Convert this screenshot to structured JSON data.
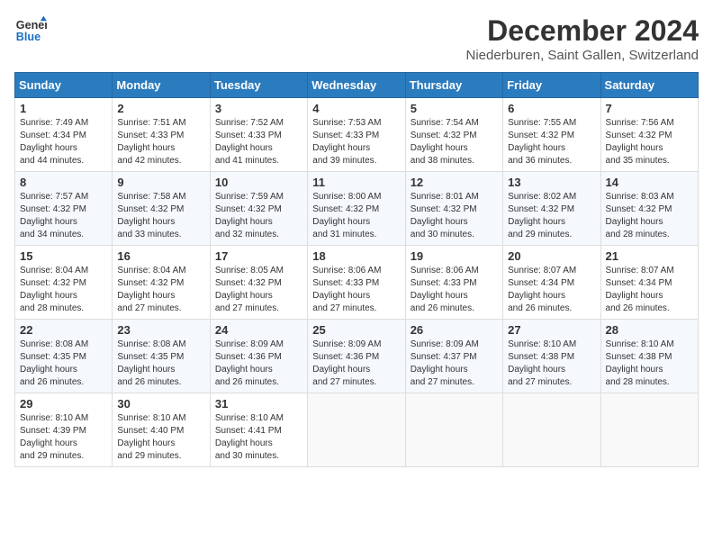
{
  "logo": {
    "line1": "General",
    "line2": "Blue"
  },
  "title": "December 2024",
  "subtitle": "Niederburen, Saint Gallen, Switzerland",
  "days_of_week": [
    "Sunday",
    "Monday",
    "Tuesday",
    "Wednesday",
    "Thursday",
    "Friday",
    "Saturday"
  ],
  "weeks": [
    [
      {
        "day": 1,
        "sunrise": "7:49 AM",
        "sunset": "4:34 PM",
        "daylight": "8 hours and 44 minutes."
      },
      {
        "day": 2,
        "sunrise": "7:51 AM",
        "sunset": "4:33 PM",
        "daylight": "8 hours and 42 minutes."
      },
      {
        "day": 3,
        "sunrise": "7:52 AM",
        "sunset": "4:33 PM",
        "daylight": "8 hours and 41 minutes."
      },
      {
        "day": 4,
        "sunrise": "7:53 AM",
        "sunset": "4:33 PM",
        "daylight": "8 hours and 39 minutes."
      },
      {
        "day": 5,
        "sunrise": "7:54 AM",
        "sunset": "4:32 PM",
        "daylight": "8 hours and 38 minutes."
      },
      {
        "day": 6,
        "sunrise": "7:55 AM",
        "sunset": "4:32 PM",
        "daylight": "8 hours and 36 minutes."
      },
      {
        "day": 7,
        "sunrise": "7:56 AM",
        "sunset": "4:32 PM",
        "daylight": "8 hours and 35 minutes."
      }
    ],
    [
      {
        "day": 8,
        "sunrise": "7:57 AM",
        "sunset": "4:32 PM",
        "daylight": "8 hours and 34 minutes."
      },
      {
        "day": 9,
        "sunrise": "7:58 AM",
        "sunset": "4:32 PM",
        "daylight": "8 hours and 33 minutes."
      },
      {
        "day": 10,
        "sunrise": "7:59 AM",
        "sunset": "4:32 PM",
        "daylight": "8 hours and 32 minutes."
      },
      {
        "day": 11,
        "sunrise": "8:00 AM",
        "sunset": "4:32 PM",
        "daylight": "8 hours and 31 minutes."
      },
      {
        "day": 12,
        "sunrise": "8:01 AM",
        "sunset": "4:32 PM",
        "daylight": "8 hours and 30 minutes."
      },
      {
        "day": 13,
        "sunrise": "8:02 AM",
        "sunset": "4:32 PM",
        "daylight": "8 hours and 29 minutes."
      },
      {
        "day": 14,
        "sunrise": "8:03 AM",
        "sunset": "4:32 PM",
        "daylight": "8 hours and 28 minutes."
      }
    ],
    [
      {
        "day": 15,
        "sunrise": "8:04 AM",
        "sunset": "4:32 PM",
        "daylight": "8 hours and 28 minutes."
      },
      {
        "day": 16,
        "sunrise": "8:04 AM",
        "sunset": "4:32 PM",
        "daylight": "8 hours and 27 minutes."
      },
      {
        "day": 17,
        "sunrise": "8:05 AM",
        "sunset": "4:32 PM",
        "daylight": "8 hours and 27 minutes."
      },
      {
        "day": 18,
        "sunrise": "8:06 AM",
        "sunset": "4:33 PM",
        "daylight": "8 hours and 27 minutes."
      },
      {
        "day": 19,
        "sunrise": "8:06 AM",
        "sunset": "4:33 PM",
        "daylight": "8 hours and 26 minutes."
      },
      {
        "day": 20,
        "sunrise": "8:07 AM",
        "sunset": "4:34 PM",
        "daylight": "8 hours and 26 minutes."
      },
      {
        "day": 21,
        "sunrise": "8:07 AM",
        "sunset": "4:34 PM",
        "daylight": "8 hours and 26 minutes."
      }
    ],
    [
      {
        "day": 22,
        "sunrise": "8:08 AM",
        "sunset": "4:35 PM",
        "daylight": "8 hours and 26 minutes."
      },
      {
        "day": 23,
        "sunrise": "8:08 AM",
        "sunset": "4:35 PM",
        "daylight": "8 hours and 26 minutes."
      },
      {
        "day": 24,
        "sunrise": "8:09 AM",
        "sunset": "4:36 PM",
        "daylight": "8 hours and 26 minutes."
      },
      {
        "day": 25,
        "sunrise": "8:09 AM",
        "sunset": "4:36 PM",
        "daylight": "8 hours and 27 minutes."
      },
      {
        "day": 26,
        "sunrise": "8:09 AM",
        "sunset": "4:37 PM",
        "daylight": "8 hours and 27 minutes."
      },
      {
        "day": 27,
        "sunrise": "8:10 AM",
        "sunset": "4:38 PM",
        "daylight": "8 hours and 27 minutes."
      },
      {
        "day": 28,
        "sunrise": "8:10 AM",
        "sunset": "4:38 PM",
        "daylight": "8 hours and 28 minutes."
      }
    ],
    [
      {
        "day": 29,
        "sunrise": "8:10 AM",
        "sunset": "4:39 PM",
        "daylight": "8 hours and 29 minutes."
      },
      {
        "day": 30,
        "sunrise": "8:10 AM",
        "sunset": "4:40 PM",
        "daylight": "8 hours and 29 minutes."
      },
      {
        "day": 31,
        "sunrise": "8:10 AM",
        "sunset": "4:41 PM",
        "daylight": "8 hours and 30 minutes."
      },
      null,
      null,
      null,
      null
    ]
  ]
}
